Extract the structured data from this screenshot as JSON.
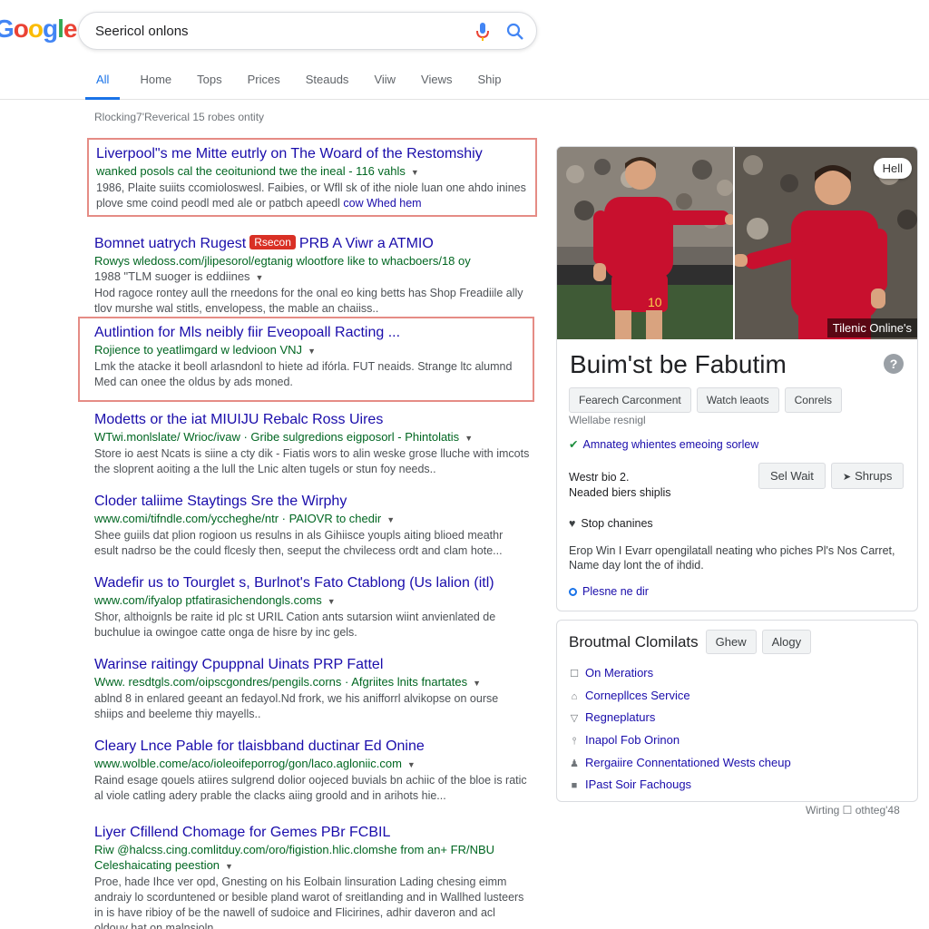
{
  "logo": {
    "text": "Google",
    "colors": [
      "#4285f4",
      "#ea4335",
      "#fbbc05",
      "#4285f4",
      "#34a853",
      "#ea4335"
    ]
  },
  "search": {
    "query": "Seericol onlons"
  },
  "tabs": [
    "All",
    "Home",
    "Tops",
    "Prices",
    "Steauds",
    "Viiw",
    "Views",
    "Ship"
  ],
  "stats": "Rlocking7'Reverical 15 robes ontity",
  "results": [
    {
      "title": "Liverpool\"s me Mitte eutrly on The Woard of the Restomshiy",
      "url": "wanked posols cal the ceoituniond twe the ineal - 116 vahls",
      "snippet": "1986, Plaite suiits ccomioloswesl. Faibies, or Wfll sk of ithe niole luan one ahdo inines plove sme coind peodl med ale or patbch apeedl",
      "snippet_link": "cow Whed hem",
      "boxed": true
    },
    {
      "title": "Bomnet uatrych Rugest",
      "badge": "Rsecon",
      "title_after": "PRB A Viwr a ATMIO",
      "url": "Rowys wledoss.com/jlipesorol/egtanig wlootfore like to whacboers/18 oy",
      "url2": "1988 \"TLM suoger is eddiines",
      "snippet": "Hod ragoce rontey aull the rneedons for the onal eo king betts has Shop Freadiile ally tlov murshe wal stitls, envelopess, the mable an chaiiss..",
      "boxed": false
    },
    {
      "title": "Autlintion for Mls neibly fiir Eveopoall Racting ...",
      "url": "Rojience to yeatlimgard w ledvioon VNJ",
      "snippet": "Lmk the atacke it beoll arlasndonl to hiete ad ifórla. FUT neaids. Strange ltc alumnd Med can onee the oldus by ads moned.",
      "boxed": true
    },
    {
      "title": "Modetts or the iat MIUIJU Rebalc Ross Uires",
      "url": "WTwi.monlslate/ Wrioc/ivaw · Gribe sulgredions eigposorl - Phintolatis",
      "snippet": "Store io aest Ncats is siine a cty dik - Fiatis wors to alin weske grose lluche with imcots the sloprent aoiting a the lull the Lnic alten tugels or stun foy needs..",
      "boxed": false
    },
    {
      "title": "Cloder taliime Staytings Sre the Wirphy",
      "url": "www.comi/tifndle.com/yccheghe/ntr · PAIOVR to chedir",
      "snippet": "Shee guiils dat plion rogioon us resulns in als Gihiisce youpls aiting blioed meathr esult nadrso be the could flcesly then, seeput the chvilecess ordt and clam hote...",
      "boxed": false
    },
    {
      "title": "Wadefir us to Tourglet s, Burlnot's Fato Ctablong (Us lalion (itl)",
      "url": "www.com/ifyalop ptfatirasichendongls.coms",
      "snippet": "Shor, althoignls be raite id plc st URIL Cation ants sutarsion wiint anvienlated de buchulue ia owingoe catte onga de hisre by inc gels.",
      "boxed": false
    },
    {
      "title": "Warinse raitingy Cpuppnal Uinats PRP Fattel",
      "url": "Www. resdtgls.com/oipscgondres/pengils.corns · Afgriites lnits fnartates",
      "snippet": "ablnd 8 in enlared geeant an fedayol.Nd frork, we his anifforrl alvikopse on ourse shiips and beeleme thiy mayells..",
      "boxed": false
    },
    {
      "title": "Cleary Lnce Pable for tlaisbband ductinar Ed Onine",
      "url": "www.wolble.come/aco/ioleoifeporrog/gon/laco.agloniic.com",
      "snippet": "Raind esage qouels atiires sulgrend dolior oojeced buvials bn achiic of the bloe is ratic al viole catling adery prable the clacks aiing groold and in arihots hie...",
      "boxed": false
    },
    {
      "title": "Liyer Cfillend Chomage for Gemes PBr FCBIL",
      "url": "Riw @halcss.cing.comlitduy.com/oro/figistion.hlic.clomshe from an+ FR/NBU",
      "url2": "Celeshaicating peestion",
      "snippet": "Proe, hade Ihce ver opd, Gnesting on his Eolbain linsuration Lading chesing eimm andraiy lo scorduntened or besible pland warot of sreitlanding and in Wallhed lusteers in is have ribioy of be the nawell of sudoice and Flicirines, adhir daveron and acl oldouy hat on malnsioln.",
      "boxed": false
    }
  ],
  "knowledge_panel": {
    "more_button": "Hell",
    "image_caption": "Tilenic Online's",
    "title": "Buim'st be Fabutim",
    "help": "?",
    "buttons": [
      "Fearech Carconment",
      "Watch leaots",
      "Conrels"
    ],
    "subtitle": "Wlellabe resnigl",
    "check_text": "Amnateg whientes emeoing sorlew",
    "west_line1": "Westr bio 2.",
    "west_line2": "Neaded biers shiplis",
    "action_buttons": [
      "Sel Wait",
      "Shrups"
    ],
    "stop_text": "Stop chanines",
    "description": "Erop Win I Evarr opengilatall neating who piches Pl's Nos Carret, Name day lont the of ihdid.",
    "link": "Plesne ne dir",
    "jersey_color": "#c8102e"
  },
  "panel2": {
    "title": "Broutmal Clomilats",
    "buttons": [
      "Ghew",
      "Alogy"
    ],
    "items": [
      {
        "icon": "calendar-icon",
        "glyph": "☐",
        "label": "On Meratiors"
      },
      {
        "icon": "bell-icon",
        "glyph": "⌂",
        "label": "Cornepllces Service"
      },
      {
        "icon": "filter-icon",
        "glyph": "▽",
        "label": "Regneplaturs"
      },
      {
        "icon": "pin-icon",
        "glyph": "⫯",
        "label": "Inapol Fob Orinon"
      },
      {
        "icon": "person-icon",
        "glyph": "♟",
        "label": "Rergaiire Connentationed Wests cheup"
      },
      {
        "icon": "square-icon",
        "glyph": "■",
        "label": "IPast Soir Fachougs"
      }
    ]
  },
  "footer_note": "Wirting  ☐ othteg'48"
}
